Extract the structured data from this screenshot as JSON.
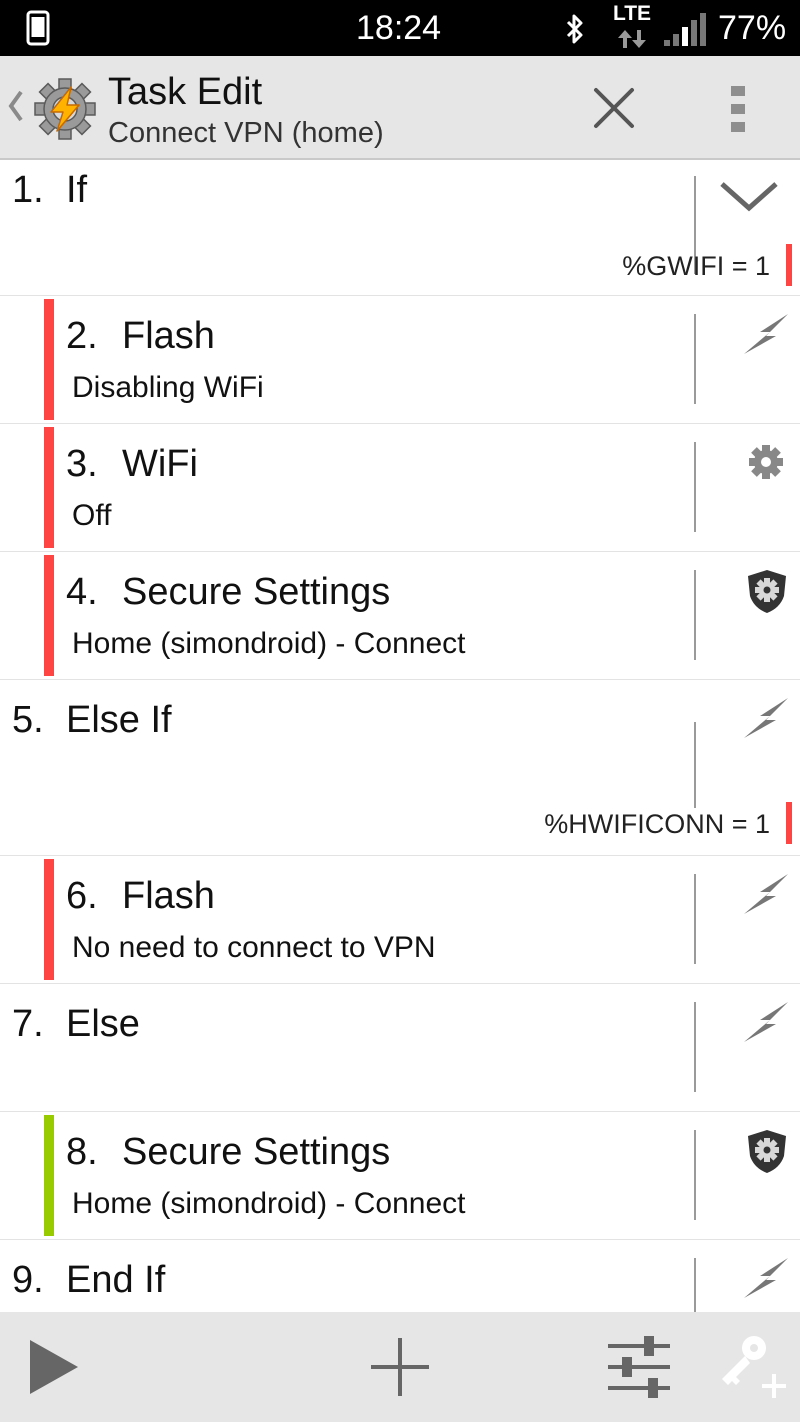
{
  "status_bar": {
    "time": "18:24",
    "network": "LTE",
    "battery": "77%"
  },
  "header": {
    "title": "Task Edit",
    "subtitle": "Connect VPN (home)"
  },
  "actions": [
    {
      "number": "1.",
      "name": "If",
      "condition": "%GWIFI = 1",
      "icon": "chevron-down-icon"
    },
    {
      "number": "2.",
      "name": "Flash",
      "detail": "Disabling WiFi",
      "icon": "flash-icon",
      "block": "red"
    },
    {
      "number": "3.",
      "name": "WiFi",
      "detail": "Off",
      "icon": "gear-icon",
      "block": "red"
    },
    {
      "number": "4.",
      "name": "Secure Settings",
      "detail": "Home (simondroid) - Connect",
      "icon": "shield-gear-icon",
      "block": "red"
    },
    {
      "number": "5.",
      "name": "Else If",
      "condition": "%HWIFICONN = 1",
      "icon": "flash-icon"
    },
    {
      "number": "6.",
      "name": "Flash",
      "detail": "No need to connect to VPN",
      "icon": "flash-icon",
      "block": "red"
    },
    {
      "number": "7.",
      "name": "Else",
      "icon": "flash-icon"
    },
    {
      "number": "8.",
      "name": "Secure Settings",
      "detail": "Home (simondroid) - Connect",
      "icon": "shield-gear-icon",
      "block": "green"
    },
    {
      "number": "9.",
      "name": "End If",
      "icon": "flash-icon"
    }
  ],
  "colors": {
    "block_red": "#ff4444",
    "block_green": "#99cc00",
    "bar_background": "#e6e6e6"
  },
  "bottom_bar": {
    "buttons": [
      "play-icon",
      "add-icon",
      "sliders-icon",
      "key-add-icon"
    ]
  }
}
